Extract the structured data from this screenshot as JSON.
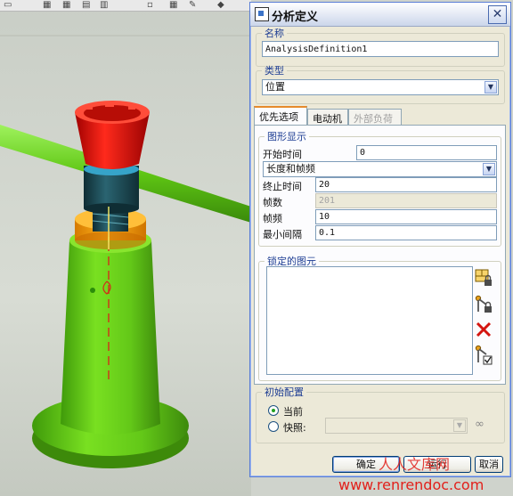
{
  "dialog": {
    "title": "分析定义",
    "close_glyph": "✕",
    "name_group": {
      "legend": "名称",
      "value": "AnalysisDefinition1"
    },
    "type_group": {
      "legend": "类型",
      "selected": "位置"
    },
    "tabs": [
      {
        "label": "优先选项",
        "state": "active"
      },
      {
        "label": "电动机",
        "state": "normal"
      },
      {
        "label": "外部负荷",
        "state": "disabled"
      }
    ],
    "graph_display": {
      "legend": "图形显示",
      "start_time_label": "开始时间",
      "start_time_value": "0",
      "mode_selected": "长度和帧频",
      "end_time_label": "终止时间",
      "end_time_value": "20",
      "frames_label": "帧数",
      "frames_value": "201",
      "frame_rate_label": "帧频",
      "frame_rate_value": "10",
      "min_interval_label": "最小间隔",
      "min_interval_value": "0.1"
    },
    "locked_entities": {
      "legend": "锁定的图元",
      "icons": [
        "lock-component-icon",
        "lock-body-icon",
        "delete-icon",
        "lock-connection-icon"
      ]
    },
    "initial_config": {
      "legend": "初始配置",
      "current_label": "当前",
      "snapshot_label": "快照:",
      "snapshot_value": "",
      "selected": "current"
    },
    "buttons": {
      "ok": "确定",
      "run": "运行",
      "cancel": "取消"
    }
  },
  "watermark": {
    "site": "www.renrendoc.com",
    "brand": "人人文库网"
  },
  "colors": {
    "title_blue": "#1d3d93",
    "tab_highlight": "#e68b2c",
    "model_green": "#6fd21c",
    "model_red": "#e01313",
    "model_orange": "#ffa300",
    "model_teal": "#1d4c57",
    "watermark_red": "#e2201b"
  }
}
